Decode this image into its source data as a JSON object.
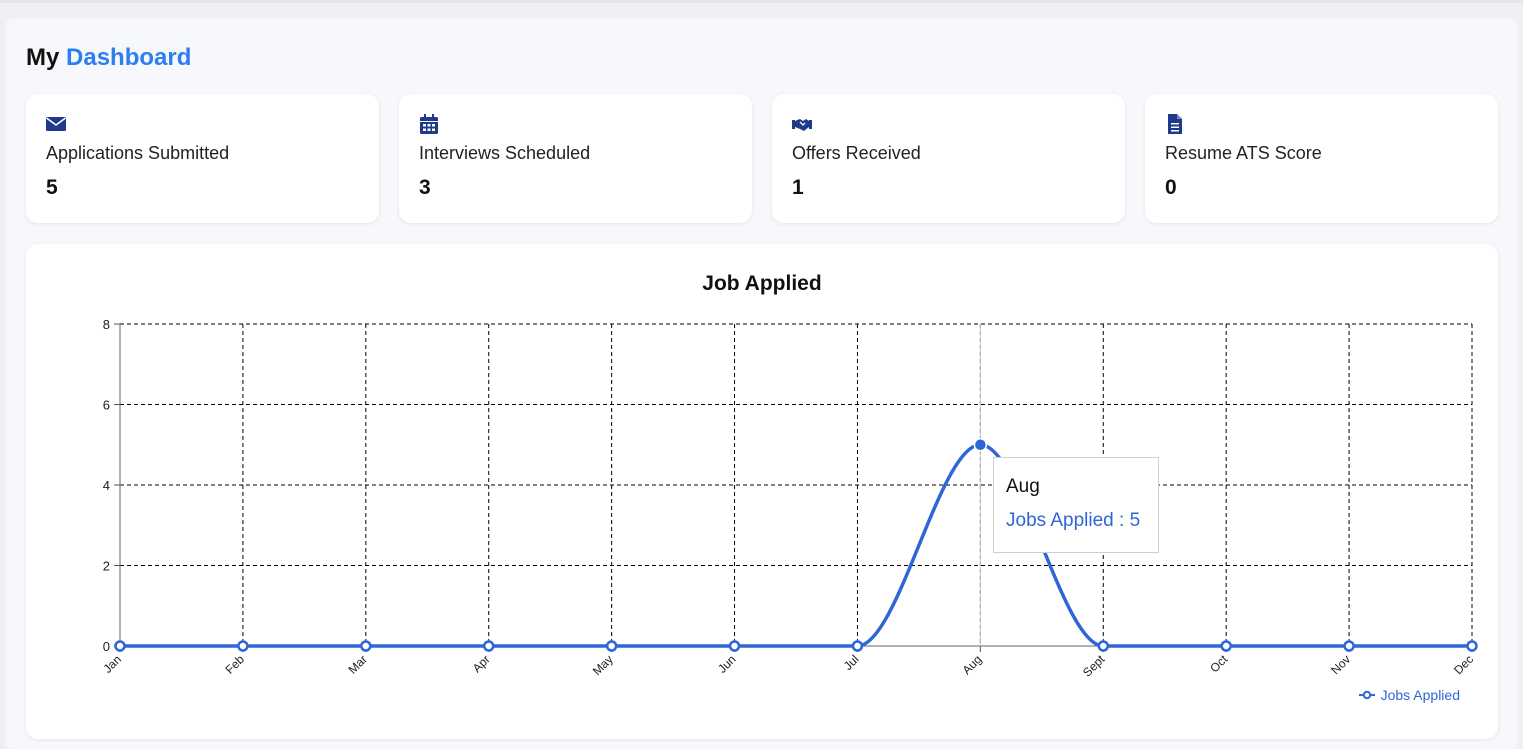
{
  "page": {
    "title_prefix": "My",
    "title_accent": "Dashboard"
  },
  "stats": [
    {
      "label": "Applications Submitted",
      "value": "5",
      "icon": "envelope-icon"
    },
    {
      "label": "Interviews Scheduled",
      "value": "3",
      "icon": "calendar-icon"
    },
    {
      "label": "Offers Received",
      "value": "1",
      "icon": "handshake-icon"
    },
    {
      "label": "Resume ATS Score",
      "value": "0",
      "icon": "document-icon"
    }
  ],
  "colors": {
    "accent": "#2d7ef0",
    "icon": "#1f3a8a",
    "series": "#2f66d6"
  },
  "chart_data": {
    "type": "line",
    "title": "Job Applied",
    "categories": [
      "Jan",
      "Feb",
      "Mar",
      "Apr",
      "May",
      "Jun",
      "Jul",
      "Aug",
      "Sept",
      "Oct",
      "Nov",
      "Dec"
    ],
    "series": [
      {
        "name": "Jobs Applied",
        "values": [
          0,
          0,
          0,
          0,
          0,
          0,
          0,
          5,
          0,
          0,
          0,
          0
        ]
      }
    ],
    "ylim": [
      0,
      8
    ],
    "yticks": [
      0,
      2,
      4,
      6,
      8
    ],
    "grid": true,
    "legend": "bottom-right",
    "tooltip": {
      "month": "Aug",
      "text": "Jobs Applied : 5"
    }
  }
}
